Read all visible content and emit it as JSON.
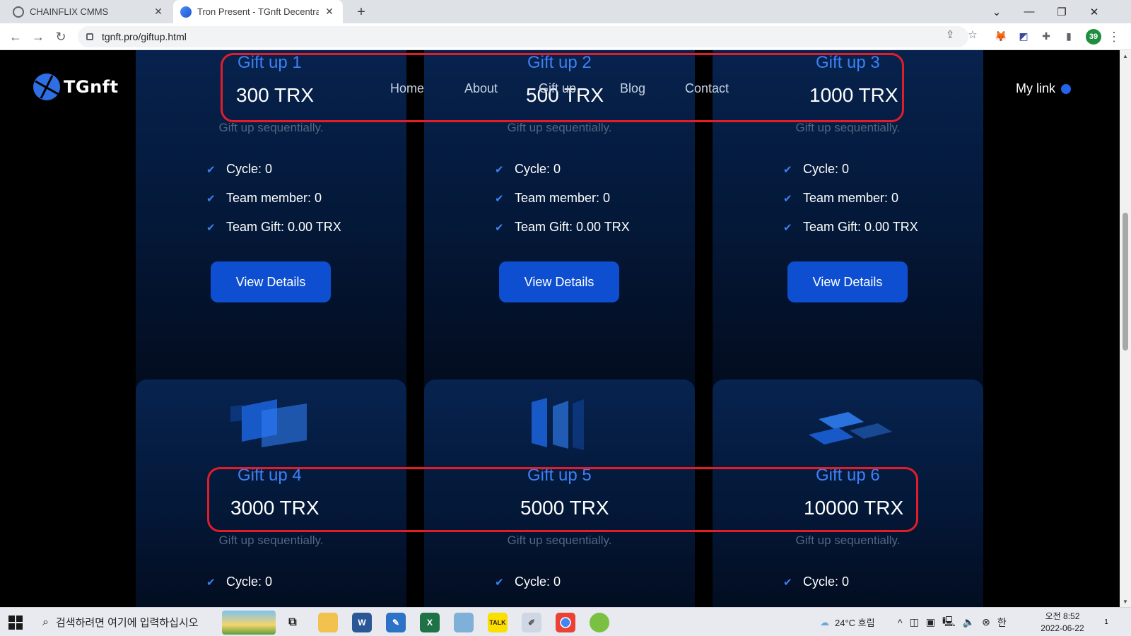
{
  "browser": {
    "tabs": [
      {
        "title": "CHAINFLIX CMMS",
        "active": false
      },
      {
        "title": "Tron Present - TGnft Decentraliz",
        "active": true
      }
    ],
    "url": "tgnft.pro/giftup.html",
    "profile_badge": "39"
  },
  "site": {
    "logo_text": "TGnft",
    "nav": [
      "Home",
      "About",
      "Gift up",
      "Blog",
      "Contact"
    ],
    "my_link": "My link",
    "accent_color": "#3b82f6",
    "button_color": "#0e4fd1",
    "highlight_color": "#e01e2a"
  },
  "cards_row1": [
    {
      "title": "Gift up 1",
      "price": "300 TRX",
      "subtitle": "Gift up sequentially.",
      "features": [
        "Cycle: 0",
        "Team member: 0",
        "Team Gift: 0.00 TRX"
      ],
      "button": "View Details"
    },
    {
      "title": "Gift up 2",
      "price": "500 TRX",
      "subtitle": "Gift up sequentially.",
      "features": [
        "Cycle: 0",
        "Team member: 0",
        "Team Gift: 0.00 TRX"
      ],
      "button": "View Details"
    },
    {
      "title": "Gift up 3",
      "price": "1000 TRX",
      "subtitle": "Gift up sequentially.",
      "features": [
        "Cycle: 0",
        "Team member: 0",
        "Team Gift: 0.00 TRX"
      ],
      "button": "View Details"
    }
  ],
  "cards_row2": [
    {
      "title": "Gift up 4",
      "price": "3000 TRX",
      "subtitle": "Gift up sequentially.",
      "features": [
        "Cycle: 0"
      ]
    },
    {
      "title": "Gift up 5",
      "price": "5000 TRX",
      "subtitle": "Gift up sequentially.",
      "features": [
        "Cycle: 0"
      ]
    },
    {
      "title": "Gift up 6",
      "price": "10000 TRX",
      "subtitle": "Gift up sequentially.",
      "features": [
        "Cycle: 0"
      ]
    }
  ],
  "taskbar": {
    "search_placeholder": "검색하려면 여기에 입력하십시오",
    "weather": "24°C 흐림",
    "ime": "한",
    "time": "오전 8:52",
    "date": "2022-06-22",
    "notification_count": "1"
  }
}
